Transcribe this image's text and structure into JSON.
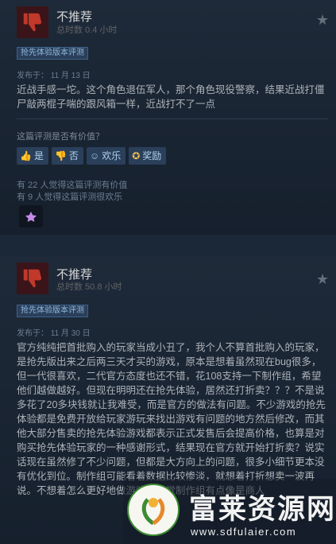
{
  "reviews": [
    {
      "verdict": "不推荐",
      "hours": "总时数 0.4 小时",
      "badge": "抢先体验版本评测",
      "posted": "发布于：  11 月 13 日",
      "body": "近战手感一坨。这个角色退伍军人，那个角色现役警察，结果近战打僵尸敲两棍子喘的跟风箱一样，近战打不了一点",
      "helpful_q": "这篇评测是否有价值？",
      "buttons": {
        "yes": "是",
        "no": "否",
        "funny": "欢乐",
        "award": "奖励"
      },
      "stat_helpful": "有 22 人觉得这篇评测有价值",
      "stat_funny": "有 9 人觉得这篇评测很欢乐"
    },
    {
      "verdict": "不推荐",
      "hours": "总时数 50.8 小时",
      "badge": "抢先体验版本评测",
      "posted": "发布于：  11 月 30 日",
      "body": "官方纯纯把首批购入的玩家当成小丑了，我个人不算首批购入的玩家，是抢先版出来之后两三天才买的游戏，原本是想着虽然现在bug很多，但一代很喜欢，二代官方态度也还不错，花108支持一下制作组，希望他们越做越好。但现在明明还在抢先体验，居然还打折卖？？？不是说多花了20多块钱就让我难受，而是官方的做法有问题。不少游戏的抢先体验都是免费开放给玩家游玩来找出游戏有问题的地方然后修改，而其他大部分售卖的抢先体验游戏都表示正式发售后会提高价格，也算是对购买抢先体验玩家的一种感谢形式，结果现在官方就开始打折卖？说实话现在虽然修了不少问题，但都是大方向上的问题，很多小细节更本没有优化到位。制作组可能看着数据比较惨淡，就想着打折想卖一波再说。不想着怎么更好地做游戏，感觉制作组有点像是商人"
    }
  ],
  "watermark": {
    "name": "富莱资源网",
    "url": "www.sdfulaier.com"
  },
  "colors": {
    "background": "#1b2838",
    "badge_text": "#8fb8e0",
    "button_bg": "#2a3f5a",
    "thumb_red": "#c0392b"
  }
}
